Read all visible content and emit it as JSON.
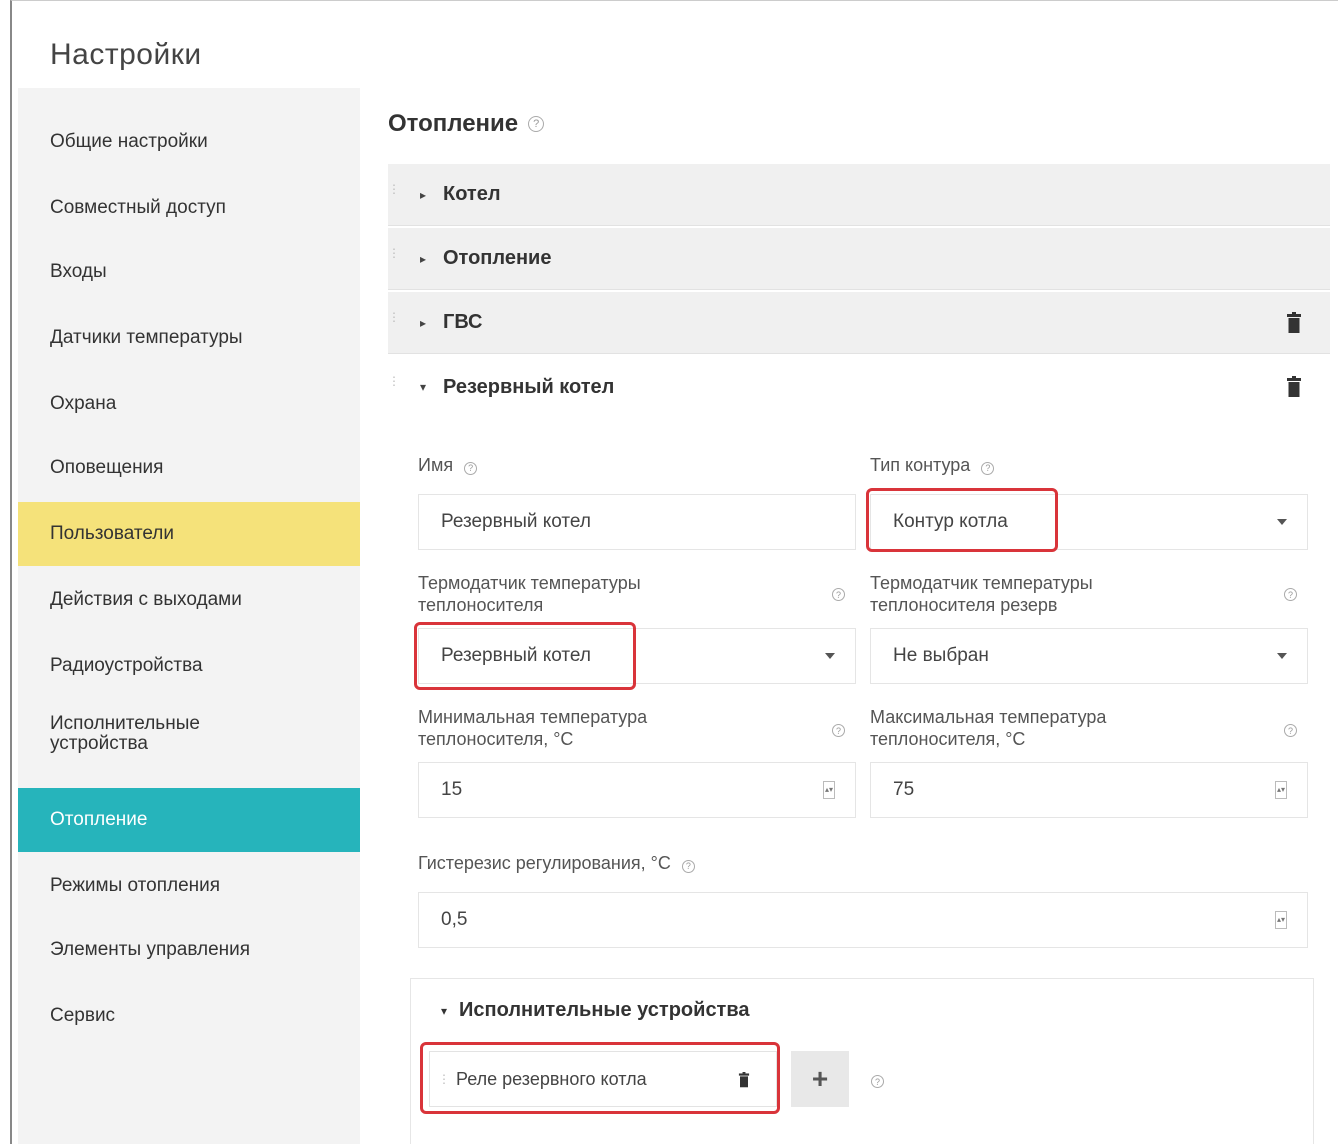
{
  "app": {
    "title": "Настройки"
  },
  "sidebar": {
    "items": [
      {
        "label": "Общие настройки"
      },
      {
        "label": "Совместный доступ"
      },
      {
        "label": "Входы"
      },
      {
        "label": "Датчики температуры"
      },
      {
        "label": "Охрана"
      },
      {
        "label": "Оповещения"
      },
      {
        "label": "Пользователи",
        "state": "highlighted"
      },
      {
        "label": "Действия с выходами"
      },
      {
        "label": "Радиоустройства"
      },
      {
        "label": "Исполнительные устройства"
      },
      {
        "label": "Отопление",
        "state": "selected"
      },
      {
        "label": "Режимы отопления"
      },
      {
        "label": "Элементы управления"
      },
      {
        "label": "Сервис"
      }
    ]
  },
  "main": {
    "title": "Отопление",
    "sections": [
      {
        "label": "Котел",
        "expanded": false
      },
      {
        "label": "Отопление",
        "expanded": false
      },
      {
        "label": "ГВС",
        "expanded": false
      },
      {
        "label": "Резервный котел",
        "expanded": true
      }
    ],
    "form": {
      "name_label": "Имя",
      "name_value": "Резервный котел",
      "circuit_type_label": "Тип контура",
      "circuit_type_value": "Контур котла",
      "sensor_label": "Термодатчик температуры теплоносителя",
      "sensor_value": "Резервный котел",
      "sensor_reserve_label": "Термодатчик температуры теплоносителя резерв",
      "sensor_reserve_value": "Не выбран",
      "min_temp_label": "Минимальная температура теплоносителя, °C",
      "min_temp_value": "15",
      "max_temp_label": "Максимальная температура теплоносителя, °C",
      "max_temp_value": "75",
      "hysteresis_label": "Гистерезис регулирования, °C",
      "hysteresis_value": "0,5"
    },
    "actuators": {
      "title": "Исполнительные устройства",
      "items": [
        {
          "label": "Реле резервного котла"
        }
      ],
      "add_label": "+"
    }
  },
  "colors": {
    "highlight_yellow": "#f5e27a",
    "selected_teal": "#26b4bb",
    "annotation_red": "#d9343a"
  },
  "icons": {
    "help": "?",
    "caret_closed": "▸",
    "caret_open": "▾"
  }
}
